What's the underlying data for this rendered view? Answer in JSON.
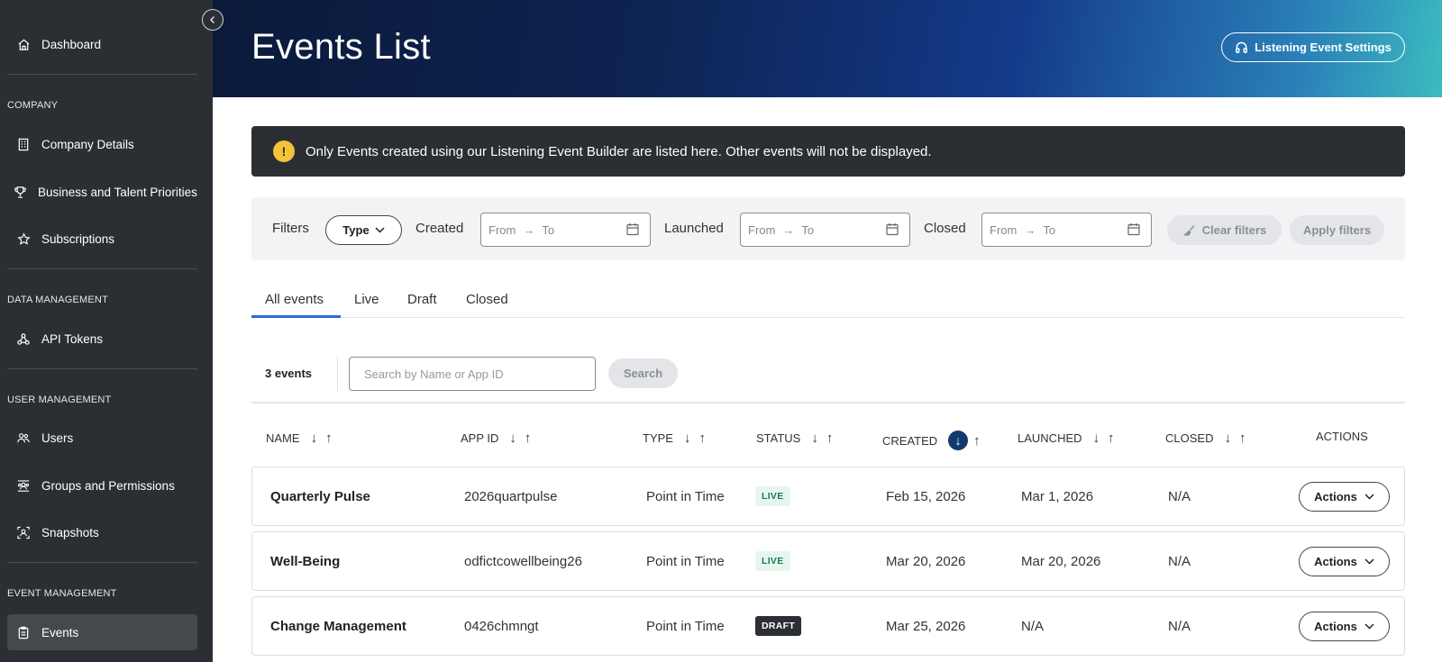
{
  "sidebar": {
    "dashboard": "Dashboard",
    "sections": {
      "company": "COMPANY",
      "data": "DATA MANAGEMENT",
      "user": "USER MANAGEMENT",
      "event": "EVENT MANAGEMENT"
    },
    "items": {
      "company_details": "Company Details",
      "priorities": "Business and Talent Priorities",
      "subscriptions": "Subscriptions",
      "api_tokens": "API Tokens",
      "users": "Users",
      "groups": "Groups and Permissions",
      "snapshots": "Snapshots",
      "events": "Events"
    },
    "active": "events"
  },
  "header": {
    "title": "Events List",
    "settings_button": "Listening Event Settings"
  },
  "notice": {
    "text": "Only Events created using our Listening Event Builder are listed here. Other events will not be displayed.",
    "icon": "!"
  },
  "filters": {
    "label": "Filters",
    "type_button": "Type",
    "created": "Created",
    "launched": "Launched",
    "closed": "Closed",
    "from": "From",
    "to": "To",
    "clear": "Clear filters",
    "apply": "Apply filters"
  },
  "tabs": [
    "All events",
    "Live",
    "Draft",
    "Closed"
  ],
  "active_tab": "All events",
  "list": {
    "count": "3 events",
    "search_placeholder": "Search by Name or App ID",
    "search_button": "Search"
  },
  "table": {
    "columns": [
      "NAME",
      "APP ID",
      "TYPE",
      "STATUS",
      "CREATED",
      "LAUNCHED",
      "CLOSED",
      "ACTIONS"
    ],
    "sorted_column": "CREATED",
    "rows": [
      {
        "name": "Quarterly Pulse",
        "app_id": "2026quartpulse",
        "type": "Point in Time",
        "status": "LIVE",
        "created": "Feb 15, 2026",
        "launched": "Mar 1, 2026",
        "closed": "N/A",
        "action": "Actions"
      },
      {
        "name": "Well-Being",
        "app_id": "odfictcowellbeing26",
        "type": "Point in Time",
        "status": "LIVE",
        "created": "Mar 20, 2026",
        "launched": "Mar 20, 2026",
        "closed": "N/A",
        "action": "Actions"
      },
      {
        "name": "Change Management",
        "app_id": "0426chmngt",
        "type": "Point in Time",
        "status": "DRAFT",
        "created": "Mar 25, 2026",
        "launched": "N/A",
        "closed": "N/A",
        "action": "Actions"
      }
    ]
  },
  "colors": {
    "sidebar_bg": "#2b2e33",
    "accent": "#2b6cd8",
    "warning": "#f5c338",
    "live_bg": "#e6f6ef",
    "live_text": "#1f7a4d"
  }
}
